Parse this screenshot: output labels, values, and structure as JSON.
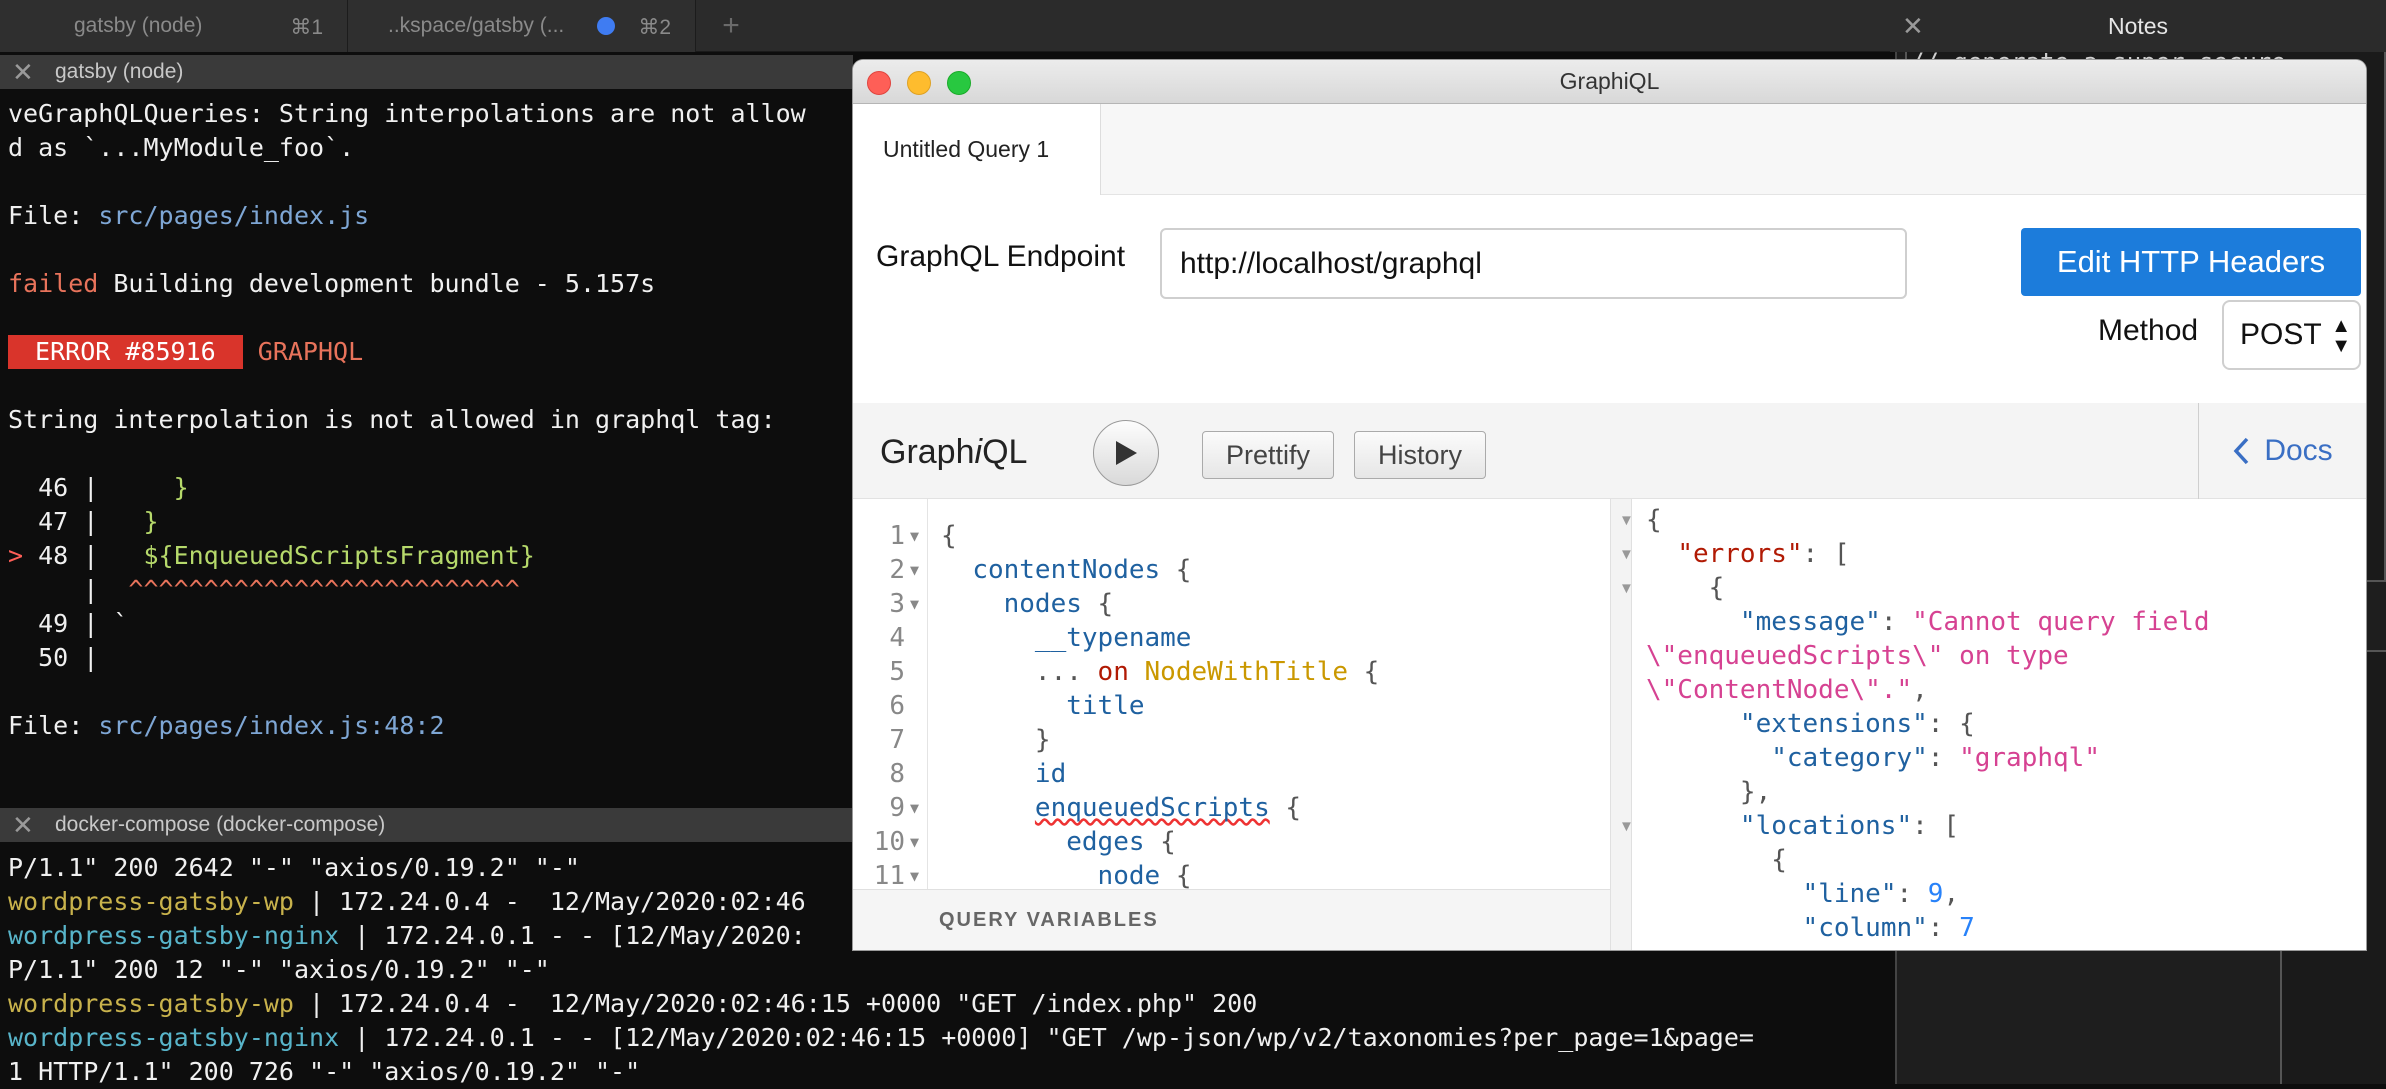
{
  "tabs": [
    {
      "label": "gatsby (node)",
      "shortcut": "⌘1"
    },
    {
      "label": "..kspace/gatsby (...",
      "shortcut": "⌘2"
    }
  ],
  "new_tab_symbol": "+",
  "pane_top": {
    "title": "gatsby (node)",
    "lines": [
      {
        "parts": [
          {
            "t": "veGraphQLQueries: String interpolations are not allow",
            "c": ""
          }
        ]
      },
      {
        "parts": [
          {
            "t": "d as `...MyModule_foo`.",
            "c": ""
          }
        ]
      },
      {
        "parts": []
      },
      {
        "parts": [
          {
            "t": "File: ",
            "c": ""
          },
          {
            "t": "src/pages/index.js",
            "c": "blue"
          }
        ]
      },
      {
        "parts": []
      },
      {
        "parts": [
          {
            "t": "failed",
            "c": "red"
          },
          {
            "t": " Building development bundle - 5.157s",
            "c": ""
          }
        ]
      },
      {
        "parts": []
      },
      {
        "parts": [
          {
            "t": " ERROR #85916 ",
            "c": "errbadge"
          },
          {
            "t": " GRAPHQL",
            "c": "red"
          }
        ]
      },
      {
        "parts": []
      },
      {
        "parts": [
          {
            "t": "String interpolation is not allowed in graphql tag:",
            "c": ""
          }
        ]
      },
      {
        "parts": []
      },
      {
        "parts": [
          {
            "t": "  46 | ",
            "c": ""
          },
          {
            "t": "    }",
            "c": "green"
          }
        ]
      },
      {
        "parts": [
          {
            "t": "  47 | ",
            "c": ""
          },
          {
            "t": "  }",
            "c": "green"
          }
        ]
      },
      {
        "parts": [
          {
            "t": "> ",
            "c": "arrow"
          },
          {
            "t": "48 | ",
            "c": ""
          },
          {
            "t": "  ${EnqueuedScriptsFragment}",
            "c": "green"
          }
        ]
      },
      {
        "parts": [
          {
            "t": "     | ",
            "c": ""
          },
          {
            "t": " ^^^^^^^^^^^^^^^^^^^^^^^^^^",
            "c": "red"
          }
        ]
      },
      {
        "parts": [
          {
            "t": "  49 | `",
            "c": ""
          }
        ]
      },
      {
        "parts": [
          {
            "t": "  50 |",
            "c": ""
          }
        ]
      },
      {
        "parts": []
      },
      {
        "parts": [
          {
            "t": "File: ",
            "c": ""
          },
          {
            "t": "src/pages/index.js:48:2",
            "c": "blue"
          }
        ]
      }
    ]
  },
  "pane_bottom": {
    "title": "docker-compose (docker-compose)",
    "lines": [
      {
        "parts": [
          {
            "t": "P/1.1\" 200 2642 \"-\" \"axios/0.19.2\" \"-\"",
            "c": ""
          }
        ]
      },
      {
        "parts": [
          {
            "t": "wordpress-gatsby-wp",
            "c": "yel"
          },
          {
            "t": " | 172.24.0.4 -  12/May/2020:02:46",
            "c": ""
          }
        ]
      },
      {
        "parts": [
          {
            "t": "wordpress-gatsby-nginx",
            "c": "cyan"
          },
          {
            "t": " | 172.24.0.1 - - [12/May/2020:",
            "c": ""
          }
        ]
      },
      {
        "parts": [
          {
            "t": "P/1.1\" 200 12 \"-\" \"axios/0.19.2\" \"-\"",
            "c": ""
          }
        ]
      },
      {
        "parts": [
          {
            "t": "wordpress-gatsby-wp",
            "c": "yel"
          },
          {
            "t": " | 172.24.0.4 -  12/May/2020:02:46:15 +0000 \"GET /index.php\" 200",
            "c": ""
          }
        ]
      },
      {
        "parts": [
          {
            "t": "wordpress-gatsby-nginx",
            "c": "cyan"
          },
          {
            "t": " | 172.24.0.1 - - [12/May/2020:02:46:15 +0000] \"GET /wp-json/wp/v2/taxonomies?per_page=1&page=",
            "c": ""
          }
        ]
      },
      {
        "parts": [
          {
            "t": "1 HTTP/1.1\" 200 726 \"-\" \"axios/0.19.2\" \"-\"",
            "c": ""
          }
        ]
      }
    ]
  },
  "notes": {
    "title": "Notes",
    "text": "// generate a super secure"
  },
  "graphiql_window": {
    "title": "GraphiQL",
    "query_tab": "Untitled Query 1",
    "endpoint_label": "GraphQL Endpoint",
    "endpoint_value": "http://localhost/graphql",
    "edit_headers": "Edit HTTP Headers",
    "method_label": "Method",
    "method_value": "POST",
    "logo": "GraphiQL",
    "prettify": "Prettify",
    "history": "History",
    "docs": "Docs",
    "query_variables": "QUERY VARIABLES",
    "query_lines": [
      {
        "n": "1",
        "fold": true,
        "parts": [
          {
            "t": "{",
            "c": ""
          }
        ]
      },
      {
        "n": "2",
        "fold": true,
        "parts": [
          {
            "t": "  ",
            "c": ""
          },
          {
            "t": "contentNodes",
            "c": "k"
          },
          {
            "t": " {",
            "c": ""
          }
        ]
      },
      {
        "n": "3",
        "fold": true,
        "parts": [
          {
            "t": "    ",
            "c": ""
          },
          {
            "t": "nodes",
            "c": "k"
          },
          {
            "t": " {",
            "c": ""
          }
        ]
      },
      {
        "n": "4",
        "fold": false,
        "parts": [
          {
            "t": "      ",
            "c": ""
          },
          {
            "t": "__typename",
            "c": "k"
          }
        ]
      },
      {
        "n": "5",
        "fold": false,
        "parts": [
          {
            "t": "      ... ",
            "c": ""
          },
          {
            "t": "on",
            "c": "kw"
          },
          {
            "t": " ",
            "c": ""
          },
          {
            "t": "NodeWithTitle",
            "c": "t"
          },
          {
            "t": " {",
            "c": ""
          }
        ]
      },
      {
        "n": "6",
        "fold": false,
        "parts": [
          {
            "t": "        ",
            "c": ""
          },
          {
            "t": "title",
            "c": "k"
          }
        ]
      },
      {
        "n": "7",
        "fold": false,
        "parts": [
          {
            "t": "      }",
            "c": ""
          }
        ]
      },
      {
        "n": "8",
        "fold": false,
        "parts": [
          {
            "t": "      ",
            "c": ""
          },
          {
            "t": "id",
            "c": "k"
          }
        ]
      },
      {
        "n": "9",
        "fold": true,
        "parts": [
          {
            "t": "      ",
            "c": ""
          },
          {
            "t": "enqueuedScripts",
            "c": "k sq"
          },
          {
            "t": " {",
            "c": ""
          }
        ]
      },
      {
        "n": "10",
        "fold": true,
        "parts": [
          {
            "t": "        ",
            "c": ""
          },
          {
            "t": "edges",
            "c": "k"
          },
          {
            "t": " {",
            "c": ""
          }
        ]
      },
      {
        "n": "11",
        "fold": true,
        "parts": [
          {
            "t": "          ",
            "c": ""
          },
          {
            "t": "node",
            "c": "k"
          },
          {
            "t": " {",
            "c": ""
          }
        ]
      }
    ],
    "result_lines": [
      {
        "fold": true,
        "parts": [
          {
            "t": "{",
            "c": ""
          }
        ]
      },
      {
        "fold": true,
        "parts": [
          {
            "t": "  ",
            "c": ""
          },
          {
            "t": "\"errors\"",
            "c": "rk"
          },
          {
            "t": ": [",
            "c": ""
          }
        ]
      },
      {
        "fold": true,
        "parts": [
          {
            "t": "    {",
            "c": ""
          }
        ]
      },
      {
        "fold": false,
        "parts": [
          {
            "t": "      ",
            "c": ""
          },
          {
            "t": "\"message\"",
            "c": "k"
          },
          {
            "t": ": ",
            "c": ""
          },
          {
            "t": "\"Cannot query field",
            "c": "rs"
          }
        ]
      },
      {
        "fold": false,
        "parts": [
          {
            "t": "\\\"enqueuedScripts\\\" on type",
            "c": "rs"
          }
        ]
      },
      {
        "fold": false,
        "parts": [
          {
            "t": "\\\"ContentNode\\\".\"",
            "c": "rs"
          },
          {
            "t": ",",
            "c": ""
          }
        ]
      },
      {
        "fold": false,
        "parts": [
          {
            "t": "      ",
            "c": ""
          },
          {
            "t": "\"extensions\"",
            "c": "k"
          },
          {
            "t": ": {",
            "c": ""
          }
        ]
      },
      {
        "fold": false,
        "parts": [
          {
            "t": "        ",
            "c": ""
          },
          {
            "t": "\"category\"",
            "c": "k"
          },
          {
            "t": ": ",
            "c": ""
          },
          {
            "t": "\"graphql\"",
            "c": "rs"
          }
        ]
      },
      {
        "fold": false,
        "parts": [
          {
            "t": "      },",
            "c": ""
          }
        ]
      },
      {
        "fold": true,
        "parts": [
          {
            "t": "      ",
            "c": ""
          },
          {
            "t": "\"locations\"",
            "c": "k"
          },
          {
            "t": ": [",
            "c": ""
          }
        ]
      },
      {
        "fold": false,
        "parts": [
          {
            "t": "        {",
            "c": ""
          }
        ]
      },
      {
        "fold": false,
        "parts": [
          {
            "t": "          ",
            "c": ""
          },
          {
            "t": "\"line\"",
            "c": "k"
          },
          {
            "t": ": ",
            "c": ""
          },
          {
            "t": "9",
            "c": "rn"
          },
          {
            "t": ",",
            "c": ""
          }
        ]
      },
      {
        "fold": false,
        "parts": [
          {
            "t": "          ",
            "c": ""
          },
          {
            "t": "\"column\"",
            "c": "k"
          },
          {
            "t": ": ",
            "c": ""
          },
          {
            "t": "7",
            "c": "rn"
          }
        ]
      }
    ]
  },
  "colors": {
    "accent_blue": "#1c7cdb",
    "error_red": "#d9342b",
    "traffic_red": "#fe5f57",
    "traffic_yellow": "#febc2e",
    "traffic_green": "#28c840"
  }
}
